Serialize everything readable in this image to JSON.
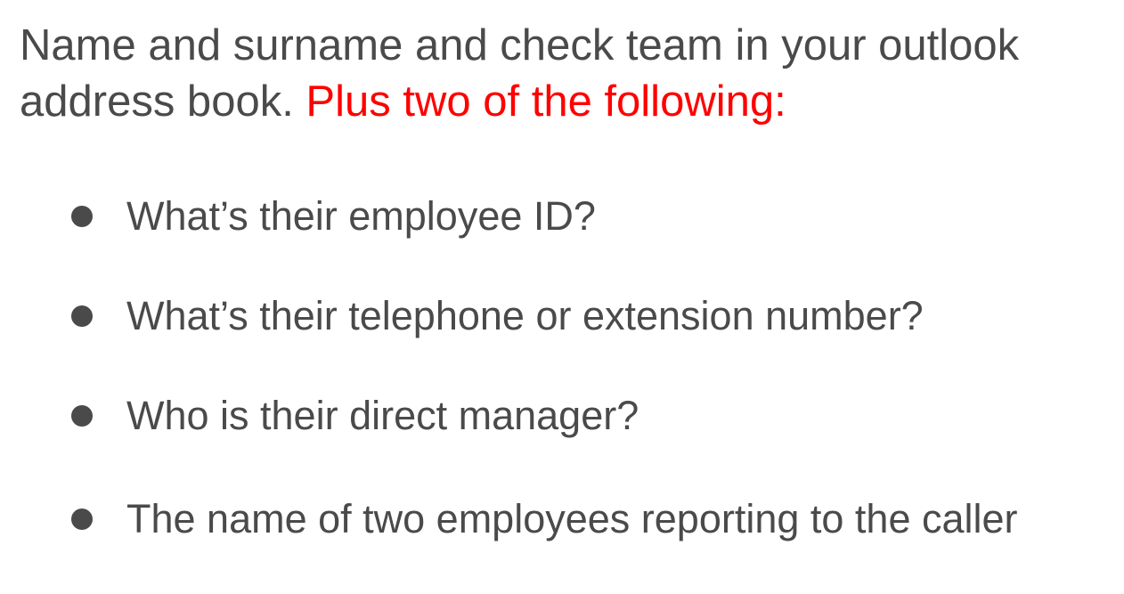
{
  "heading": {
    "main_text": "Name and surname and check team in your outlook address book. ",
    "emphasis_text": "Plus two of the following:",
    "emphasis_color": "#ff0000",
    "text_color": "#4a4a4a"
  },
  "bullets": [
    "What’s their employee ID?",
    "What’s their telephone or extension number?",
    "Who is their direct manager?",
    "The name of two employees reporting to the caller"
  ]
}
